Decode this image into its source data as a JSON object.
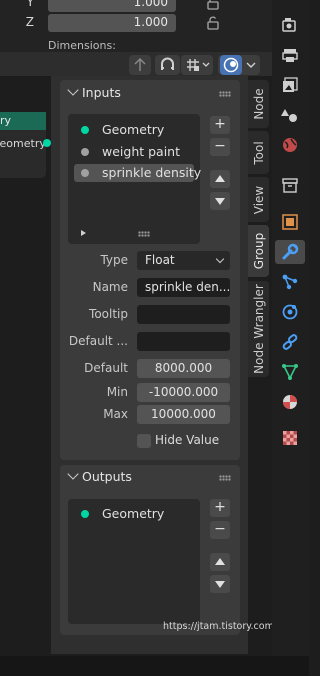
{
  "transform": {
    "rows": [
      {
        "axis": "Y",
        "value": "1.000"
      },
      {
        "axis": "Z",
        "value": "1.000"
      }
    ],
    "dimensions_label": "Dimensions:"
  },
  "node": {
    "title": "ry",
    "output_label": "Geometry"
  },
  "inputs_panel": {
    "title": "Inputs",
    "items": [
      {
        "label": "Geometry",
        "socket_color": "#00d6a3"
      },
      {
        "label": "weight paint",
        "socket_color": "#a1a1a1"
      },
      {
        "label": "sprinkle density",
        "socket_color": "#a1a1a1"
      }
    ],
    "selected_index": 2,
    "properties": {
      "type_label": "Type",
      "type_value": "Float",
      "name_label": "Name",
      "name_value": "sprinkle den...",
      "tooltip_label": "Tooltip",
      "tooltip_value": "",
      "default_attr_label": "Default ...",
      "default_attr_value": "",
      "default_label": "Default",
      "default_value": "8000.000",
      "min_label": "Min",
      "min_value": "-10000.000",
      "max_label": "Max",
      "max_value": "10000.000",
      "hide_value_label": "Hide Value",
      "hide_value_checked": false
    }
  },
  "outputs_panel": {
    "title": "Outputs",
    "items": [
      {
        "label": "Geometry",
        "socket_color": "#00d6a3"
      }
    ]
  },
  "list_buttons": {
    "add": "+",
    "remove": "−"
  },
  "tabs": [
    {
      "label": "Node",
      "active": false
    },
    {
      "label": "Tool",
      "active": false
    },
    {
      "label": "View",
      "active": false
    },
    {
      "label": "Group",
      "active": true
    },
    {
      "label": "Node Wrangler",
      "active": false
    }
  ],
  "property_icons": [
    "render-icon",
    "output-icon",
    "view-layer-icon",
    "scene-icon",
    "world-icon",
    "collection-icon",
    "object-icon",
    "modifier-icon",
    "particles-icon",
    "physics-icon",
    "constraints-icon",
    "data-icon",
    "material-icon",
    "texture-icon"
  ],
  "colors": {
    "accent_socket_geometry": "#00d6a3",
    "socket_float": "#a1a1a1",
    "node_header": "#1b6a55",
    "active_overlay_button": "#4772b3"
  },
  "watermark": "https://jtam.tistory.com"
}
